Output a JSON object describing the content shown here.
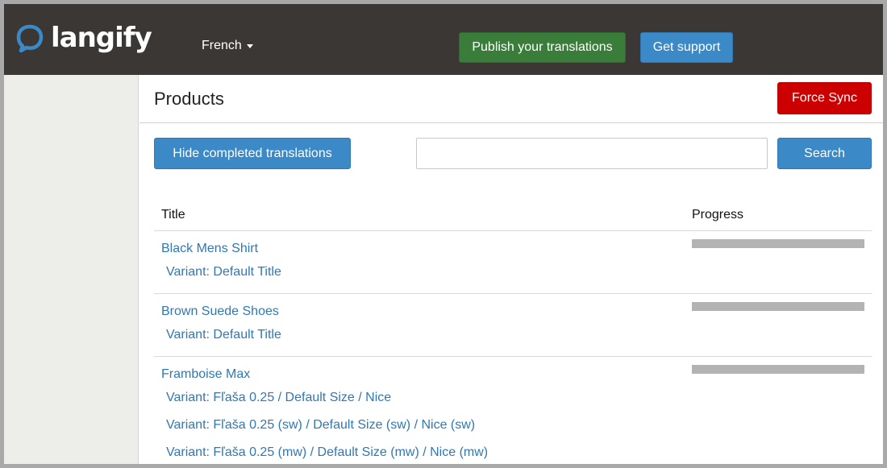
{
  "app": {
    "logo_text": "langify",
    "brand_color": "#3c89c8"
  },
  "header": {
    "language": "French",
    "publish_label": "Publish your translations",
    "support_label": "Get support"
  },
  "page": {
    "title": "Products",
    "force_sync_label": "Force Sync",
    "hide_completed_label": "Hide completed translations",
    "search_value": "",
    "search_label": "Search"
  },
  "table": {
    "columns": [
      "Title",
      "Progress"
    ],
    "rows": [
      {
        "title": "Black Mens Shirt",
        "variants": [
          "Variant: Default Title"
        ],
        "progress": 0
      },
      {
        "title": "Brown Suede Shoes",
        "variants": [
          "Variant: Default Title"
        ],
        "progress": 0
      },
      {
        "title": "Framboise Max",
        "variants": [
          "Variant: Fľaša 0.25 / Default Size / Nice",
          "Variant: Fľaša 0.25 (sw) / Default Size (sw) / Nice (sw)",
          "Variant: Fľaša 0.25 (mw) / Default Size (mw) / Nice (mw)"
        ],
        "progress": 0
      }
    ]
  },
  "colors": {
    "topbar": "#3b3735",
    "publish": "#3a7d3a",
    "force_sync": "#cc0000",
    "primary": "#3c89c8",
    "link": "#2f78b4",
    "progress_track": "#b3b3b3"
  }
}
